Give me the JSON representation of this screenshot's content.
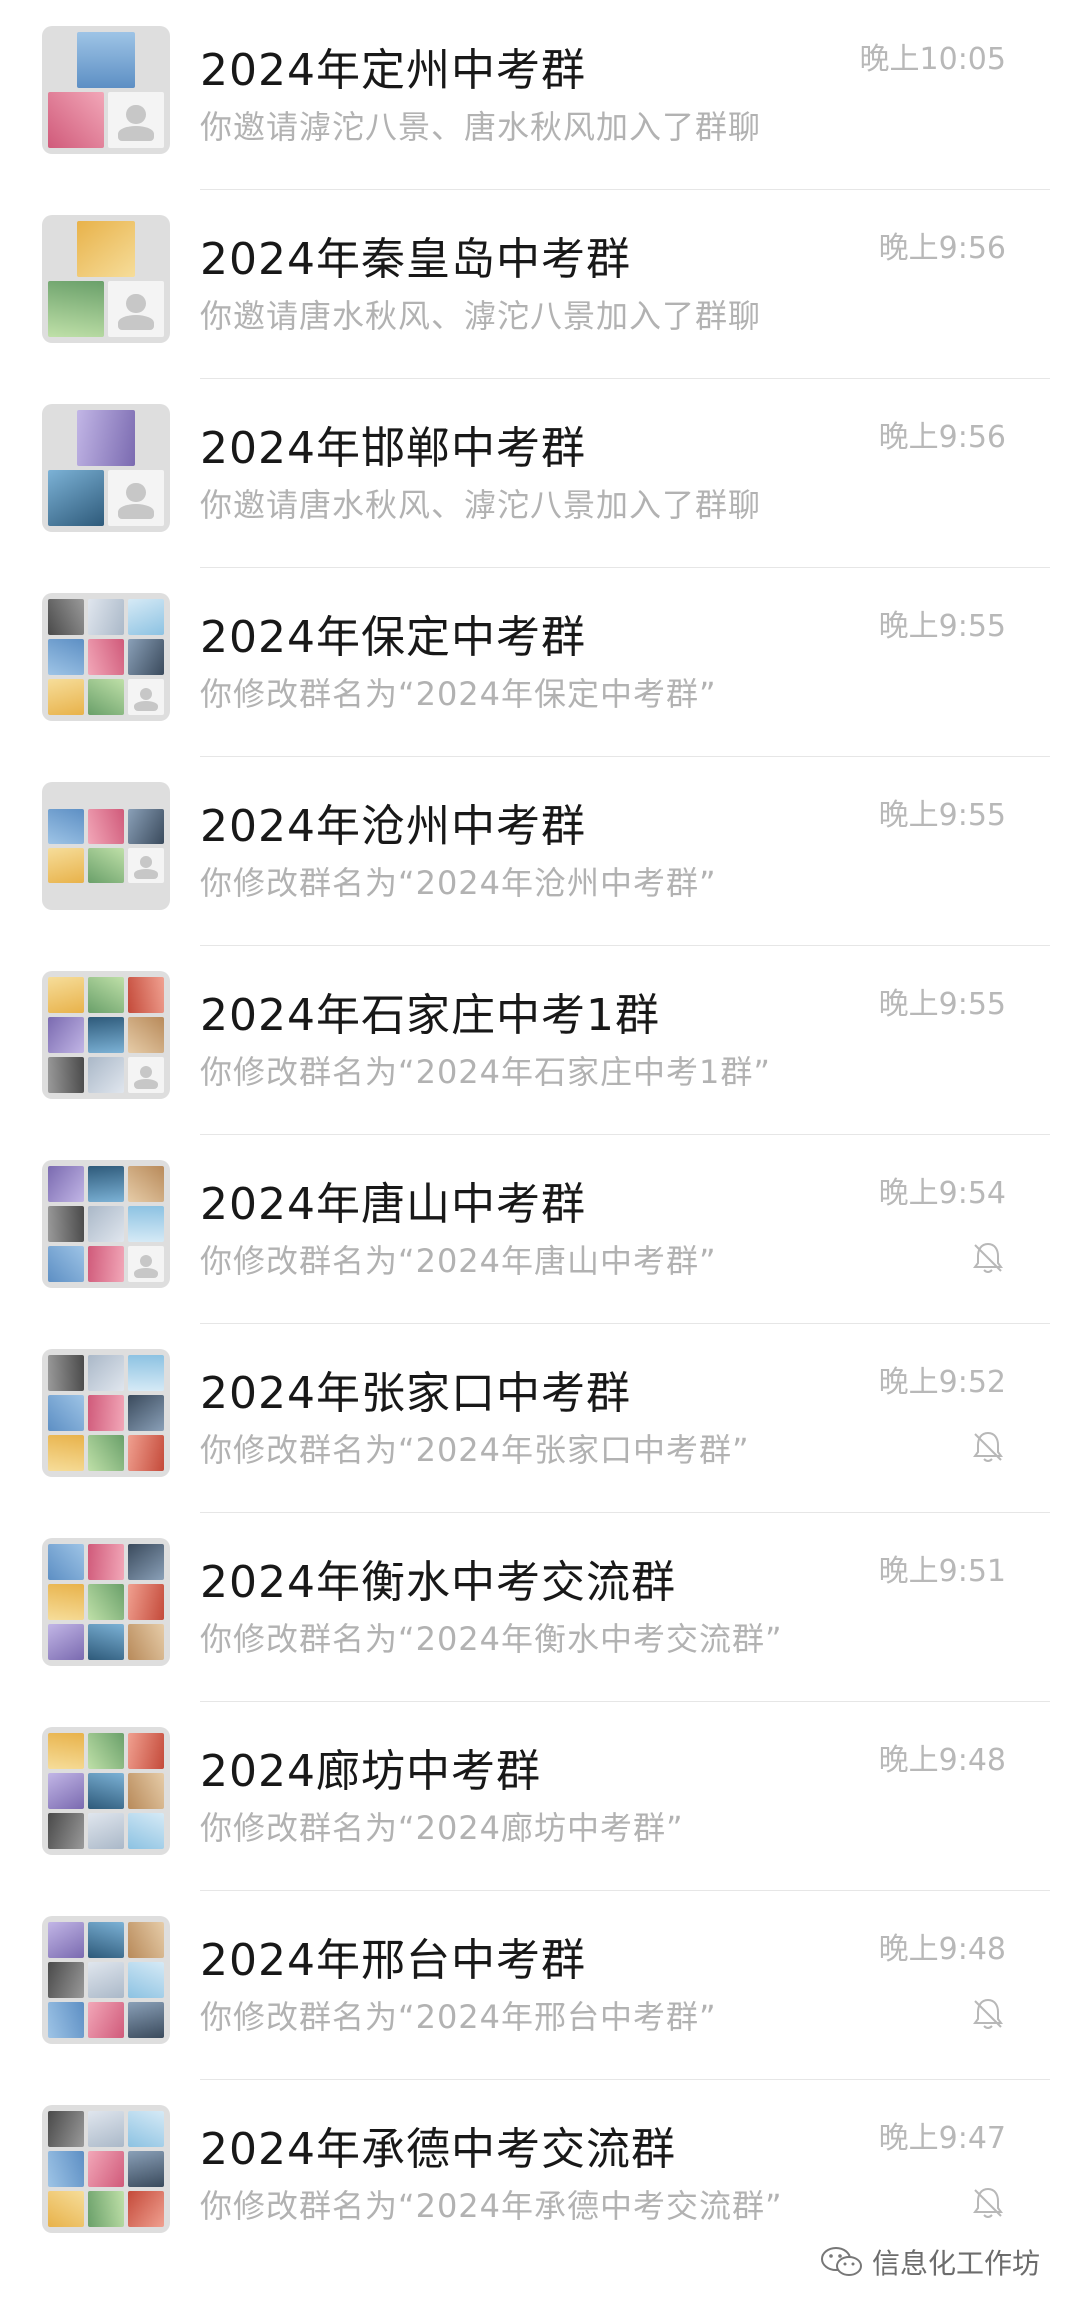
{
  "colors": {
    "title": "#181818",
    "subtitle": "#b2b2b2",
    "time": "#b8b8b8",
    "divider": "#e6e6e6",
    "avatar_bg": "#dedede"
  },
  "chats": [
    {
      "title": "2024年定州中考群",
      "preview": "你邀请滹沱八景、唐水秋风加入了群聊",
      "time": "晚上10:05",
      "muted": false,
      "avatar_layout": "small",
      "avatar_icon": "group-avatar"
    },
    {
      "title": "2024年秦皇岛中考群",
      "preview": "你邀请唐水秋风、滹沱八景加入了群聊",
      "time": "晚上9:56",
      "muted": false,
      "avatar_layout": "small",
      "avatar_icon": "group-avatar"
    },
    {
      "title": "2024年邯郸中考群",
      "preview": "你邀请唐水秋风、滹沱八景加入了群聊",
      "time": "晚上9:56",
      "muted": false,
      "avatar_layout": "small",
      "avatar_icon": "group-avatar"
    },
    {
      "title": "2024年保定中考群",
      "preview": "你修改群名为“2024年保定中考群”",
      "time": "晚上9:55",
      "muted": false,
      "avatar_layout": "full",
      "avatar_icon": "group-avatar"
    },
    {
      "title": "2024年沧州中考群",
      "preview": "你修改群名为“2024年沧州中考群”",
      "time": "晚上9:55",
      "muted": false,
      "avatar_layout": "partial",
      "avatar_icon": "group-avatar"
    },
    {
      "title": "2024年石家庄中考1群",
      "preview": "你修改群名为“2024年石家庄中考1群”",
      "time": "晚上9:55",
      "muted": false,
      "avatar_layout": "full",
      "avatar_icon": "group-avatar"
    },
    {
      "title": "2024年唐山中考群",
      "preview": "你修改群名为“2024年唐山中考群”",
      "time": "晚上9:54",
      "muted": true,
      "avatar_layout": "full",
      "avatar_icon": "group-avatar"
    },
    {
      "title": "2024年张家口中考群",
      "preview": "你修改群名为“2024年张家口中考群”",
      "time": "晚上9:52",
      "muted": true,
      "avatar_layout": "fullnouser",
      "avatar_icon": "group-avatar"
    },
    {
      "title": "2024年衡水中考交流群",
      "preview": "你修改群名为“2024年衡水中考交流群”",
      "time": "晚上9:51",
      "muted": false,
      "avatar_layout": "fullnouser",
      "avatar_icon": "group-avatar"
    },
    {
      "title": "2024廊坊中考群",
      "preview": "你修改群名为“2024廊坊中考群”",
      "time": "晚上9:48",
      "muted": false,
      "avatar_layout": "fullnouser",
      "avatar_icon": "group-avatar"
    },
    {
      "title": "2024年邢台中考群",
      "preview": "你修改群名为“2024年邢台中考群”",
      "time": "晚上9:48",
      "muted": true,
      "avatar_layout": "fullnouser",
      "avatar_icon": "group-avatar"
    },
    {
      "title": "2024年承德中考交流群",
      "preview": "你修改群名为“2024年承德中考交流群”",
      "time": "晚上9:47",
      "muted": true,
      "avatar_layout": "fullnouser",
      "avatar_icon": "group-avatar"
    }
  ],
  "watermark": {
    "text": "信息化工作坊",
    "icon": "wechat-icon"
  }
}
